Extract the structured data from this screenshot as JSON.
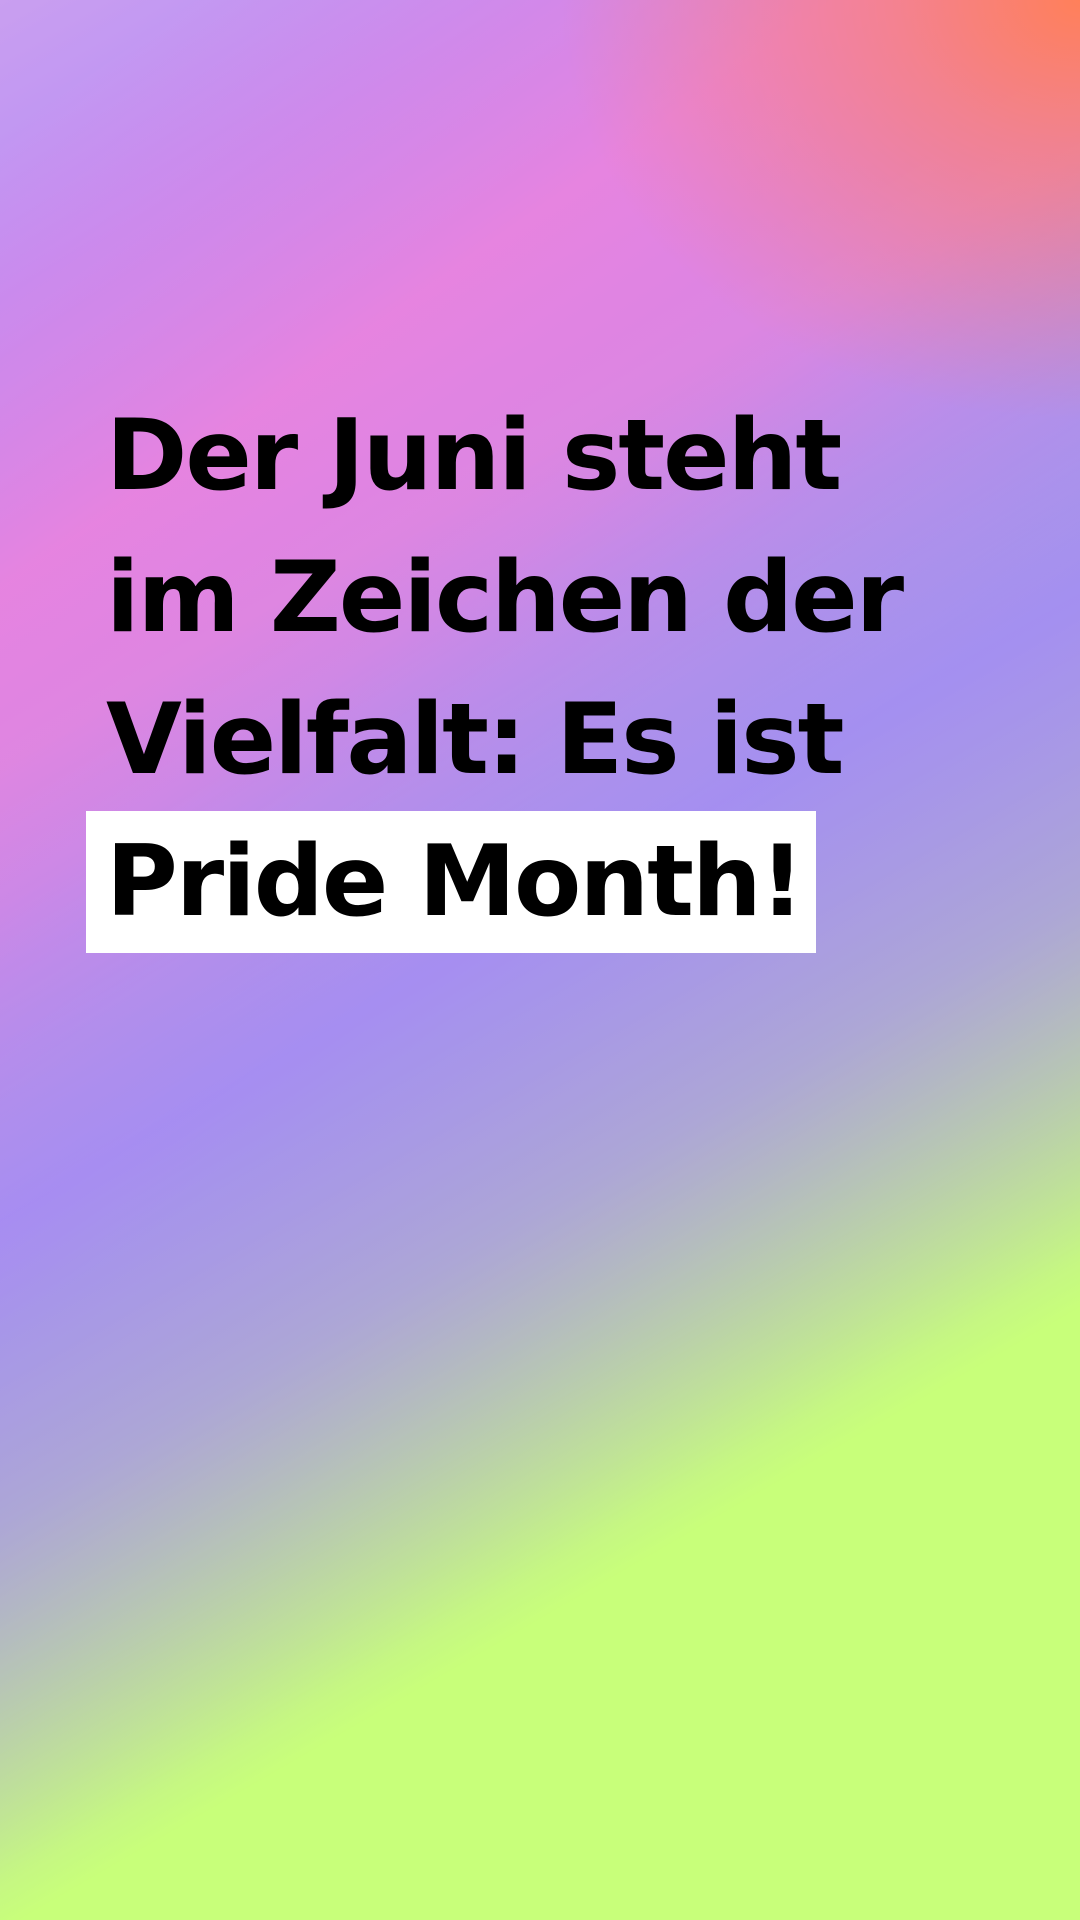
{
  "headline": {
    "line1": "Der Juni steht",
    "line2": "im Zeichen der",
    "line3": "Vielfalt: Es ist",
    "highlight": "Pride Month!"
  },
  "colors": {
    "text": "#000000",
    "highlight_background": "#ffffff",
    "gradient_orange": "#ff805a",
    "gradient_pink": "#f082dc",
    "gradient_violet": "#a082ff",
    "gradient_lime": "#c8ff7a"
  }
}
